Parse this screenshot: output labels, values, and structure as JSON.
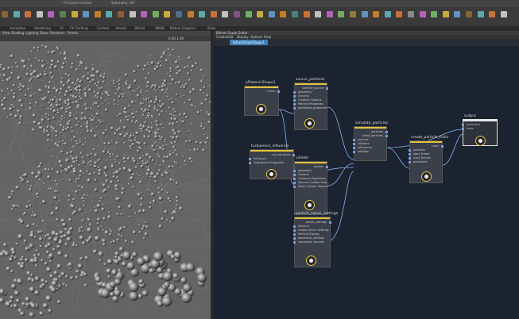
{
  "shelf": {
    "top_text": [
      "",
      "FX Cache Limited",
      "Symmetry: Off"
    ],
    "menu_tabs": [
      "Animation",
      "Rendering",
      "FX",
      "FX Caching",
      "Custom",
      "Arnold",
      "Bifrost",
      "MASH",
      "Motion Graphics",
      "XGen"
    ],
    "left_tabs": [
      "nimation"
    ]
  },
  "viewport": {
    "menu": [
      "View",
      "Shading",
      "Lighting",
      "Show",
      "Renderer",
      "Panels"
    ],
    "stat": "0.00  1.00"
  },
  "graph_editor": {
    "title": "Bifrost Graph Editor",
    "menu": [
      "Create",
      "Edit",
      "Display",
      "Options",
      "Help"
    ],
    "tab": "bifrostGraphShape1"
  },
  "nodes": [
    {
      "id": "pPlatonicShape1",
      "title": "pPlatonicShape1",
      "ports": [
        "mesh"
      ]
    },
    {
      "id": "source_particles",
      "title": "source_particles",
      "ports": [
        "particle_source",
        "geometry",
        "General",
        "Creation Options",
        "Particle Properties",
        "additional_properties"
      ]
    },
    {
      "id": "turbulence_influence",
      "title": "turbulence_influence",
      "ports": [
        "out_influence",
        "Influence",
        "Turbulence Properties"
      ]
    },
    {
      "id": "collider",
      "title": "collider",
      "ports": [
        "collider",
        "geometry",
        "General",
        "Common Properties",
        "Volume Collider Prop...",
        "Mesh Collider Propert..."
      ]
    },
    {
      "id": "particle_solver_settings",
      "title": "particle_solver_settings",
      "ports": [
        "solver_settings",
        "General",
        "Global Solver Settings",
        "Particle Display",
        "additional_settings",
        "simulation_bounds"
      ]
    },
    {
      "id": "simulate_particles",
      "title": "simulate_particles",
      "ports": [
        "particles",
        "killed_particles",
        "sources",
        "colliders",
        "influences",
        "settings"
      ]
    },
    {
      "id": "create_particle_trails",
      "title": "create_particle_trails",
      "ports": [
        "trails",
        "particles",
        "start_frame",
        "num_frames",
        "persistent"
      ]
    },
    {
      "id": "output",
      "title": "output",
      "ports": [
        "particles1",
        "trails"
      ]
    }
  ]
}
